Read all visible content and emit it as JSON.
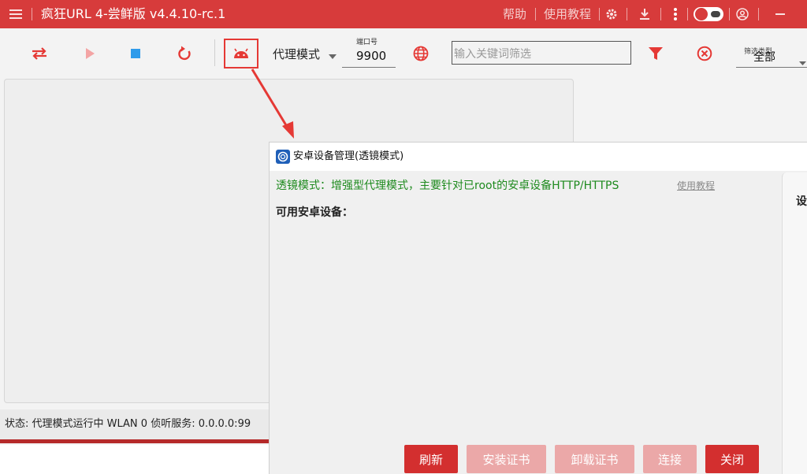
{
  "titlebar": {
    "title": "疯狂URL 4-尝鲜版 v4.4.10-rc.1",
    "help": "帮助",
    "tutorial": "使用教程"
  },
  "toolbar": {
    "proxy_mode": "代理模式",
    "port_label": "端口号",
    "port_value": "9900",
    "filter_placeholder": "输入关键词筛选",
    "filter_select_label": "筛选类型",
    "filter_select_value": "全部"
  },
  "statusbar": {
    "text": "状态:  代理模式运行中  WLAN 0  侦听服务: 0.0.0.0:99"
  },
  "dialog": {
    "title": "安卓设备管理(透镜模式)",
    "hint": "透镜模式：增强型代理模式，主要针对已root的安卓设备HTTP/HTTPS",
    "tutorial_link": "使用教程",
    "devices_label": "可用安卓设备：",
    "settings_label": "设",
    "buttons": {
      "refresh": "刷新",
      "install_cert": "安装证书",
      "uninstall_cert": "卸载证书",
      "connect": "连接",
      "close": "关闭"
    }
  },
  "colors": {
    "brand_red": "#d73b3b",
    "hint_green": "#1e8a1e",
    "highlight_red": "#e53935"
  }
}
